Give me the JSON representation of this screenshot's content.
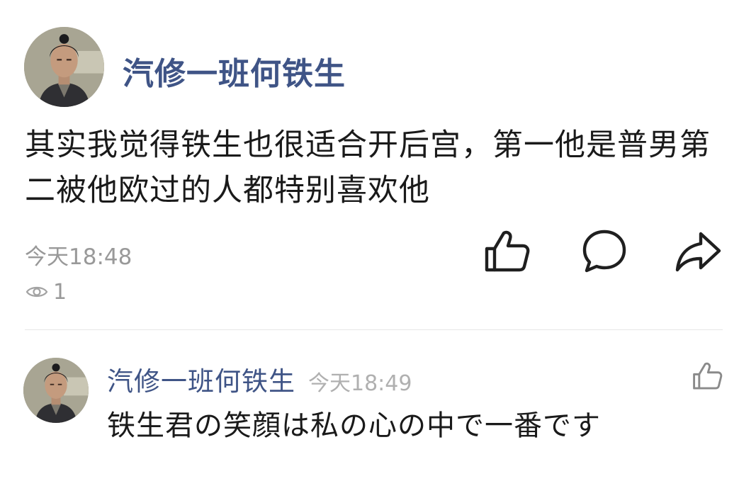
{
  "post": {
    "author": "汽修一班何铁生",
    "text": "其实我觉得铁生也很适合开后宫，第一他是普男第二被他欧过的人都特别喜欢他",
    "time": "今天18:48",
    "views": "1",
    "actions": [
      "like-icon",
      "comment-icon",
      "share-icon"
    ]
  },
  "reply": {
    "author": "汽修一班何铁生",
    "time": "今天18:49",
    "text": "铁生君の笑顔は私の心の中で一番です"
  },
  "colors": {
    "author": "#3f5486",
    "meta": "#999999",
    "text": "#1a1a1a",
    "divider": "#e6e6e6"
  }
}
